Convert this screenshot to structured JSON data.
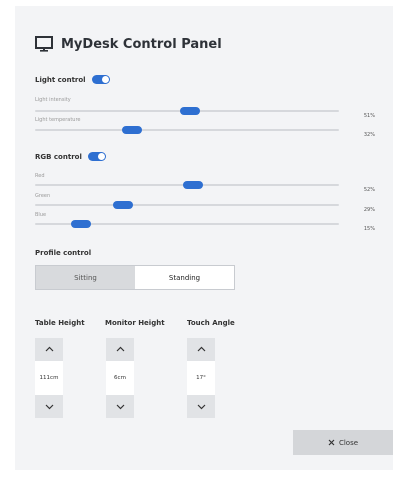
{
  "header": {
    "title": "MyDesk Control Panel",
    "icon": "monitor-icon"
  },
  "light": {
    "label": "Light control",
    "enabled": true,
    "sliders": [
      {
        "label": "Light intensity",
        "value": "51%",
        "fraction": 0.51
      },
      {
        "label": "Light temperature",
        "value": "32%",
        "fraction": 0.32
      }
    ]
  },
  "rgb": {
    "label": "RGB control",
    "enabled": true,
    "sliders": [
      {
        "label": "Red",
        "value": "52%",
        "fraction": 0.52
      },
      {
        "label": "Green",
        "value": "29%",
        "fraction": 0.29
      },
      {
        "label": "Blue",
        "value": "15%",
        "fraction": 0.15
      }
    ]
  },
  "profile": {
    "label": "Profile control",
    "options": [
      "Sitting",
      "Standing"
    ],
    "selected": "Standing"
  },
  "steppers": [
    {
      "label": "Table Height",
      "value": "111cm"
    },
    {
      "label": "Monitor Height",
      "value": "6cm"
    },
    {
      "label": "Touch Angle",
      "value": "17°"
    }
  ],
  "close": {
    "label": "Close",
    "icon": "close-icon"
  },
  "colors": {
    "accent": "#2e6fd1",
    "panel": "#f3f4f6"
  }
}
